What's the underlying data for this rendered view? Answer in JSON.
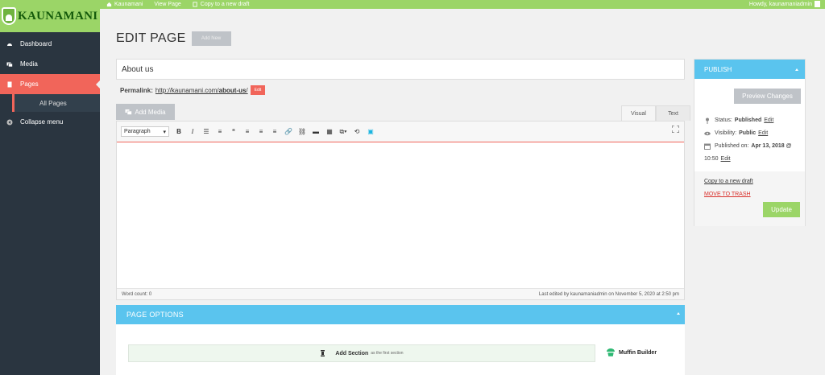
{
  "topbar": {
    "site_name": "Kaunamani",
    "view_page": "View Page",
    "copy_draft": "Copy to a new draft",
    "howdy": "Howdy, kaunamaniadmin"
  },
  "brand": {
    "name": "KAUNAMANI"
  },
  "sidebar": {
    "items": [
      {
        "label": "Dashboard",
        "icon": "dashboard-icon"
      },
      {
        "label": "Media",
        "icon": "media-icon"
      },
      {
        "label": "Pages",
        "icon": "pages-icon"
      },
      {
        "label": "Collapse menu",
        "icon": "collapse-icon"
      }
    ],
    "sub_items": [
      {
        "label": "All Pages"
      }
    ]
  },
  "page": {
    "title": "EDIT PAGE",
    "add_new": "Add New",
    "post_title": "About us",
    "permalink_label": "Permalink:",
    "permalink_base": "http://kaunamani.com/",
    "permalink_slug": "about-us",
    "permalink_end": "/",
    "permalink_edit": "Edit"
  },
  "editor": {
    "add_media": "Add Media",
    "tab_visual": "Visual",
    "tab_text": "Text",
    "format_select": "Paragraph",
    "word_count": "Word count: 0",
    "last_edited": "Last edited by kaunamaniadmin on November 5, 2020 at 2:50 pm"
  },
  "page_options": {
    "title": "PAGE OPTIONS",
    "add_section": "Add Section",
    "add_section_note": "as the first section",
    "builder": "Muffin Builder"
  },
  "publish": {
    "title": "PUBLISH",
    "preview": "Preview Changes",
    "status_label": "Status:",
    "status_value": "Published",
    "visibility_label": "Visibility:",
    "visibility_value": "Public",
    "published_label": "Published on:",
    "published_value": "Apr 13, 2018 @",
    "published_time": "10:50",
    "edit": "Edit",
    "copy_draft": "Copy to a new draft",
    "trash": "MOVE TO TRASH",
    "update": "Update"
  },
  "colors": {
    "accent_green": "#9bd567",
    "accent_blue": "#5ac4ee",
    "accent_red": "#f1655a",
    "sidebar_bg": "#2a3540"
  }
}
